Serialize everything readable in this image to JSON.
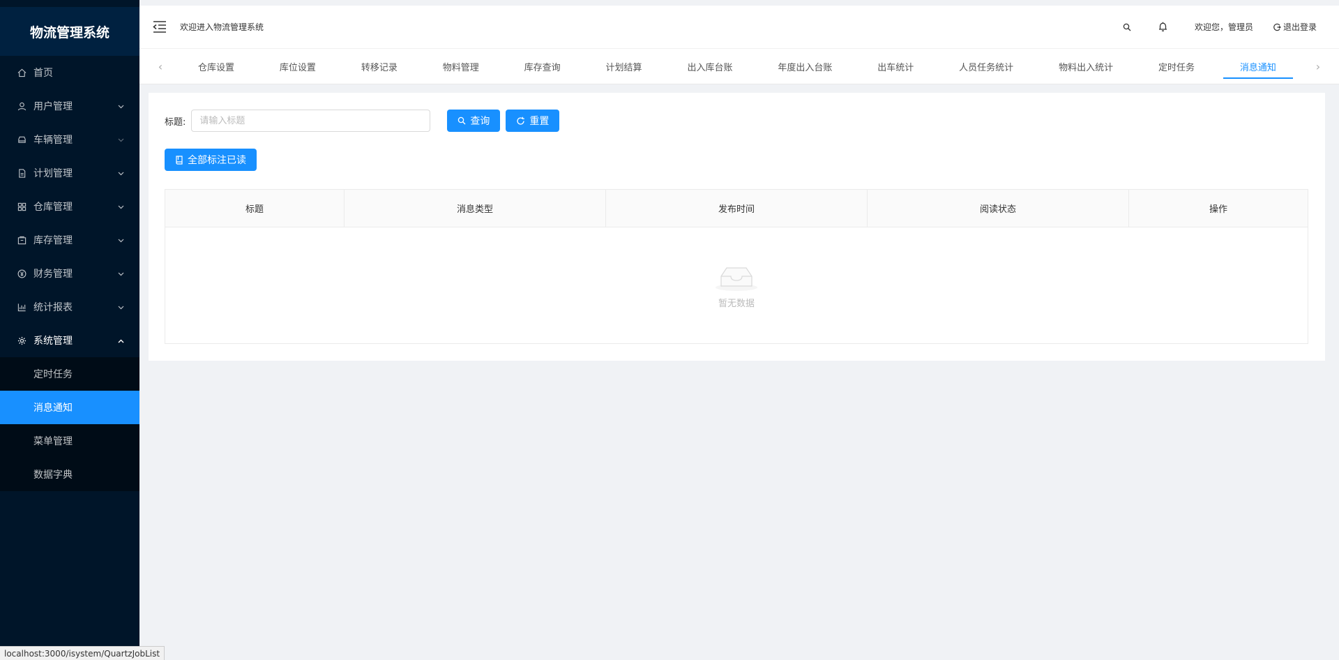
{
  "app": {
    "title": "物流管理系统"
  },
  "sidebar": {
    "items": [
      {
        "label": "首页",
        "icon": "home-icon",
        "has_children": false
      },
      {
        "label": "用户管理",
        "icon": "user-icon",
        "has_children": true
      },
      {
        "label": "车辆管理",
        "icon": "car-icon",
        "has_children": true
      },
      {
        "label": "计划管理",
        "icon": "document-icon",
        "has_children": true
      },
      {
        "label": "仓库管理",
        "icon": "grid-icon",
        "has_children": true
      },
      {
        "label": "库存管理",
        "icon": "box-icon",
        "has_children": true
      },
      {
        "label": "财务管理",
        "icon": "yen-icon",
        "has_children": true
      },
      {
        "label": "统计报表",
        "icon": "bar-chart-icon",
        "has_children": true
      },
      {
        "label": "系统管理",
        "icon": "gear-icon",
        "has_children": true,
        "open": true
      }
    ],
    "submenu": [
      {
        "label": "定时任务",
        "active": false
      },
      {
        "label": "消息通知",
        "active": true
      },
      {
        "label": "菜单管理",
        "active": false
      },
      {
        "label": "数据字典",
        "active": false
      }
    ]
  },
  "header": {
    "welcome": "欢迎进入物流管理系统",
    "greeting": "欢迎您，管理员",
    "logout": "退出登录"
  },
  "tabs": {
    "prev": "‹",
    "next": "›",
    "items": [
      {
        "label": "仓库设置",
        "active": false
      },
      {
        "label": "库位设置",
        "active": false
      },
      {
        "label": "转移记录",
        "active": false
      },
      {
        "label": "物料管理",
        "active": false
      },
      {
        "label": "库存查询",
        "active": false
      },
      {
        "label": "计划结算",
        "active": false
      },
      {
        "label": "出入库台账",
        "active": false
      },
      {
        "label": "年度出入台账",
        "active": false
      },
      {
        "label": "出车统计",
        "active": false
      },
      {
        "label": "人员任务统计",
        "active": false
      },
      {
        "label": "物料出入统计",
        "active": false
      },
      {
        "label": "定时任务",
        "active": false
      },
      {
        "label": "消息通知",
        "active": true
      }
    ]
  },
  "search": {
    "label": "标题:",
    "placeholder": "请输入标题",
    "value": "",
    "query_label": "查询",
    "reset_label": "重置"
  },
  "actions": {
    "mark_all_read": "全部标注已读"
  },
  "table": {
    "columns": [
      {
        "label": "标题"
      },
      {
        "label": "消息类型"
      },
      {
        "label": "发布时间"
      },
      {
        "label": "阅读状态"
      },
      {
        "label": "操作"
      }
    ],
    "empty_text": "暂无数据"
  },
  "statusbar": {
    "url": "localhost:3000/isystem/QuartzJobList"
  },
  "colors": {
    "primary": "#1890ff",
    "sidebar_bg": "#001529",
    "submenu_bg": "#000c17"
  }
}
